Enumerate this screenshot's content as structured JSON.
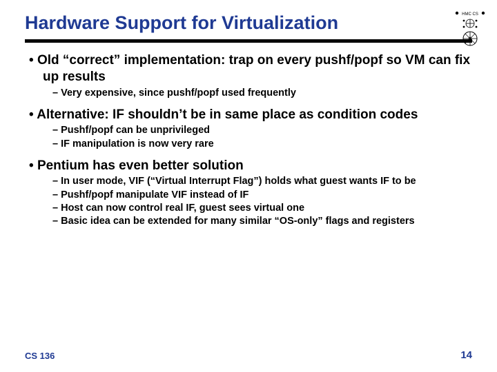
{
  "title": "Hardware Support for Virtualization",
  "bullets": {
    "b1a": "Old “correct” implementation: trap on every pushf/popf so VM can fix up results",
    "b1a_s1": "Very expensive, since pushf/popf used frequently",
    "b1b": "Alternative: IF shouldn’t be in same place as condition codes",
    "b1b_s1": "Pushf/popf can be unprivileged",
    "b1b_s2": "IF manipulation is now very rare",
    "b1c": "Pentium has even better solution",
    "b1c_s1": "In user mode, VIF (“Virtual Interrupt Flag”) holds what guest wants IF to be",
    "b1c_s2": "Pushf/popf manipulate VIF instead of IF",
    "b1c_s3": "Host can now control real IF, guest sees virtual one",
    "b1c_s4": "Basic idea can be extended for many similar “OS-only” flags and registers"
  },
  "footer": {
    "course": "CS 136",
    "page": "14"
  },
  "logo": {
    "name": "hmc-cs-logo"
  }
}
